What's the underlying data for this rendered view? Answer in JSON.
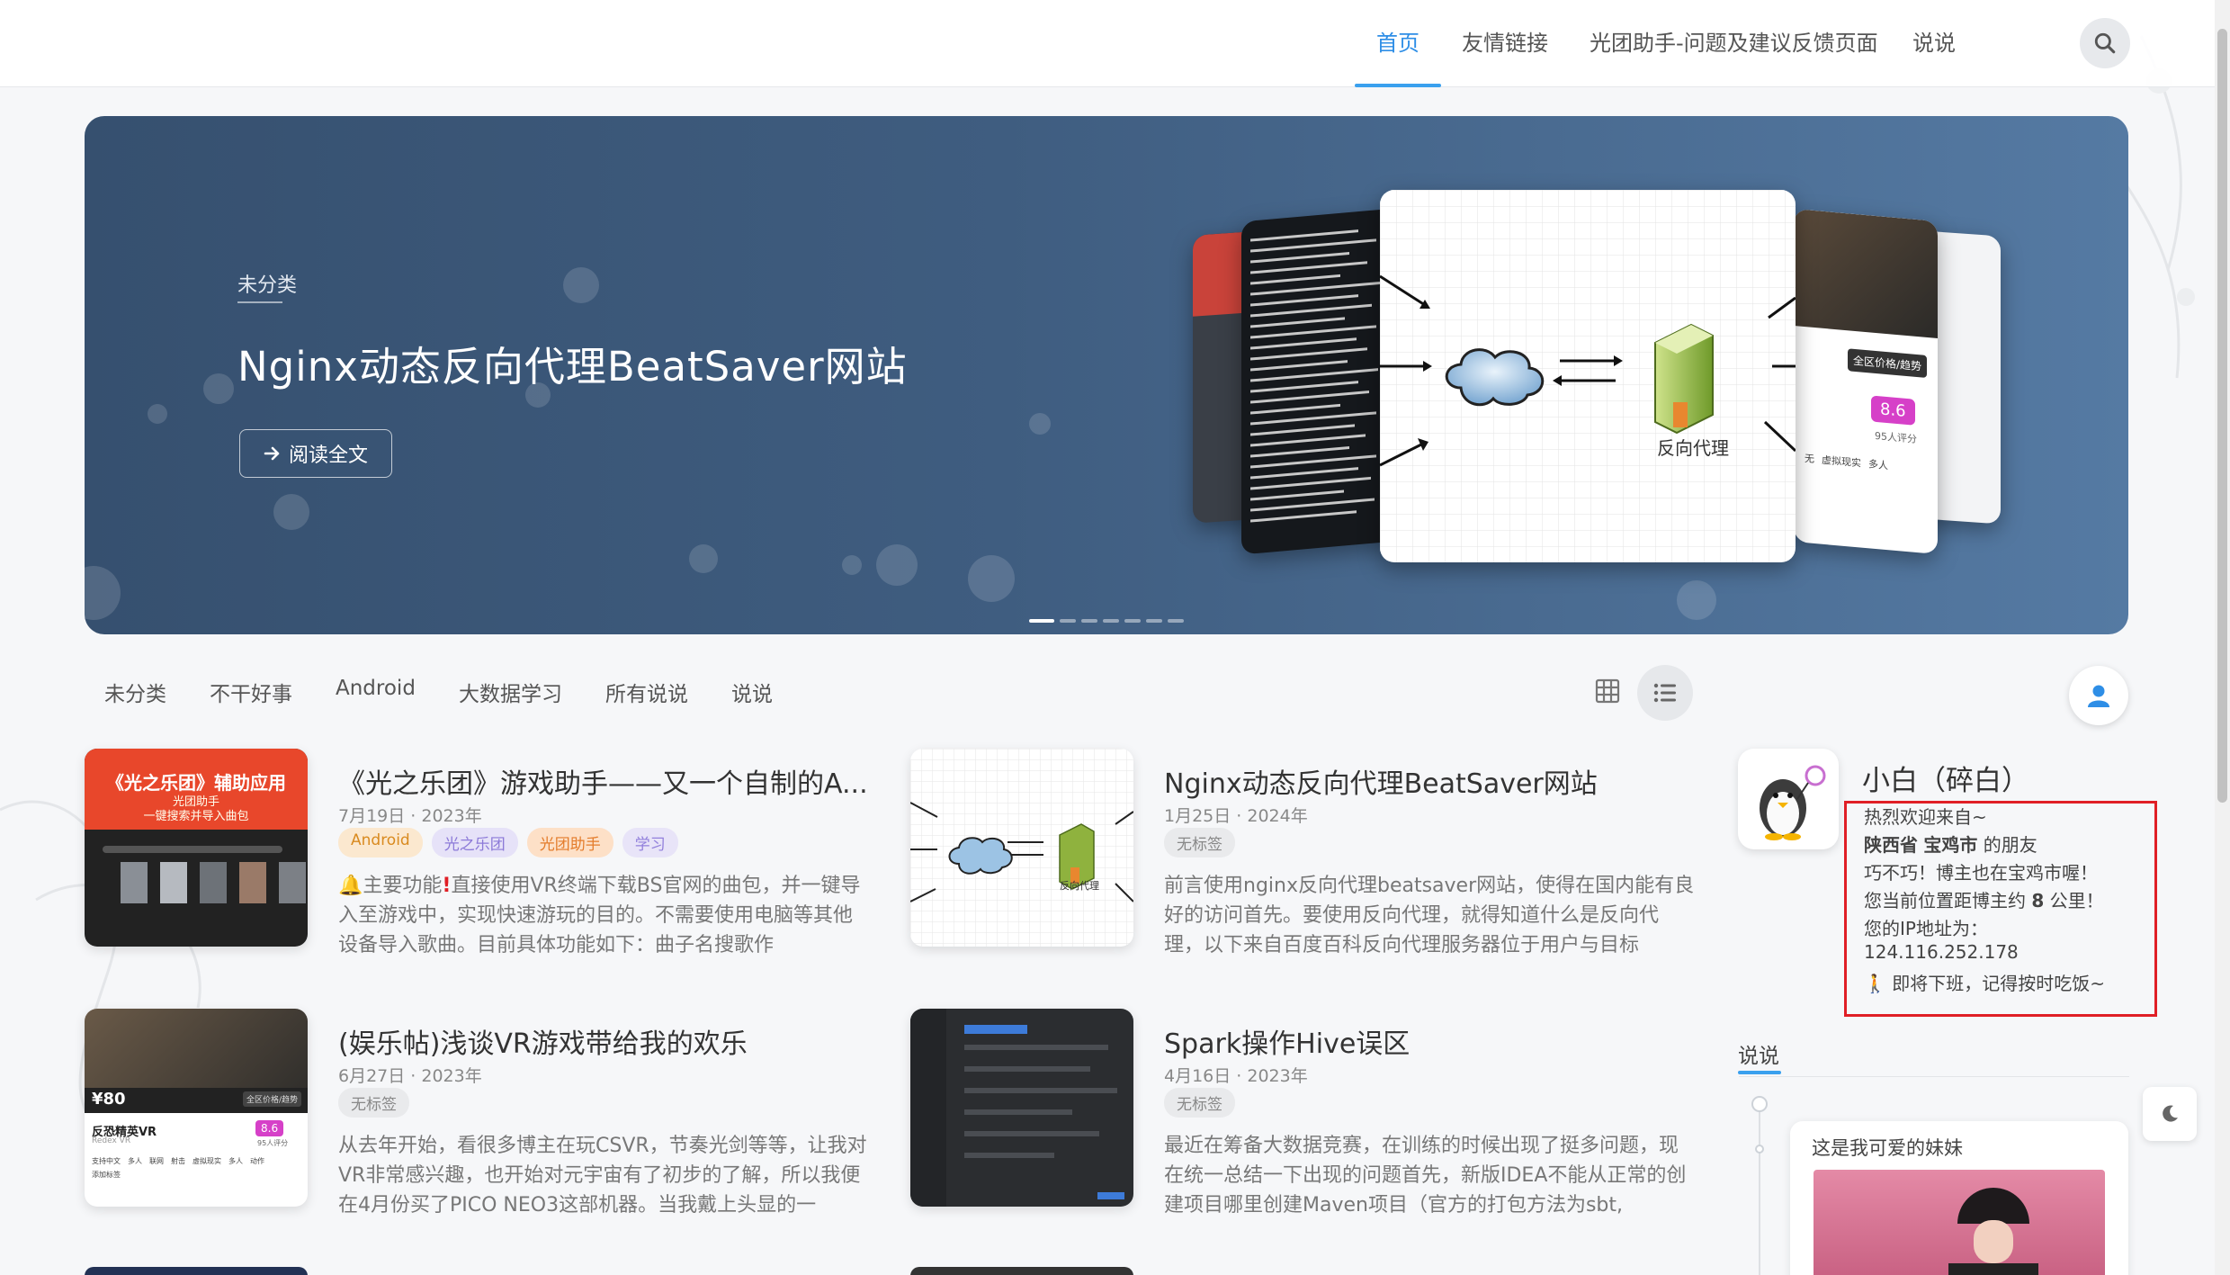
{
  "nav": {
    "items": [
      {
        "label": "首页",
        "active": true
      },
      {
        "label": "友情链接",
        "active": false
      },
      {
        "label": "光团助手-问题及建议反馈页面",
        "active": false
      },
      {
        "label": "说说",
        "active": false
      }
    ],
    "search_icon": "search-icon"
  },
  "hero": {
    "category": "未分类",
    "title": "Nginx动态反向代理BeatSaver网站",
    "read_button": "阅读全文",
    "read_icon": "arrow-right-icon",
    "diagram_label": "反向代理",
    "card_price": "8.6",
    "card_price_caption": "95人评分",
    "card_button": "全区价格/趋势",
    "card_tags": [
      "无",
      "虚拟现实",
      "多人"
    ],
    "slide_count": 7,
    "active_slide": 1
  },
  "categories": [
    "未分类",
    "不干好事",
    "Android",
    "大数据学习",
    "所有说说",
    "说说"
  ],
  "posts": [
    {
      "title": "《光之乐团》游戏助手——又一个自制的A...",
      "date": "7月19日 · 2023年",
      "tags": [
        {
          "label": "Android",
          "style": "and"
        },
        {
          "label": "光之乐团",
          "style": "gzl"
        },
        {
          "label": "光团助手",
          "style": "gzs"
        },
        {
          "label": "学习",
          "style": "xx"
        }
      ],
      "excerpt_icon": "bell-icon",
      "excerpt_mark_icon": "exclamation-icon",
      "excerpt_prefix": "主要功能",
      "excerpt": "直接使用VR终端下载BS官网的曲包，并一键导入至游戏中，实现快速游玩的目的。不需要使用电脑等其他设备导入歌曲。目前具体功能如下：曲子名搜歌作",
      "thumb_title": "《光之乐团》辅助应用",
      "thumb_sub1": "光团助手",
      "thumb_sub2": "一键搜索并导入曲包"
    },
    {
      "title": "Nginx动态反向代理BeatSaver网站",
      "date": "1月25日 · 2024年",
      "tags": [
        {
          "label": "无标签",
          "style": "none"
        }
      ],
      "excerpt": "前言使用nginx反向代理beatsaver网站，使得在国内能有良好的访问首先。要使用反向代理，就得知道什么是反向代理，以下来自百度百科反向代理服务器位于用户与目标",
      "thumb_label": "反向代理"
    },
    {
      "title": "(娱乐帖)浅谈VR游戏带给我的欢乐",
      "date": "6月27日 · 2023年",
      "tags": [
        {
          "label": "无标签",
          "style": "none"
        }
      ],
      "excerpt": "从去年开始，看很多博主在玩CSVR，节奏光剑等等，让我对VR非常感兴趣，也开始对元宇宙有了初步的了解，所以我便在4月份买了PICO NEO3这部机器。当我戴上头显的一",
      "thumb_price": "¥80",
      "thumb_game": "反恐精英VR",
      "thumb_sub": "Redex VR",
      "thumb_score": "8.6",
      "thumb_score_caption": "95人评分",
      "thumb_button": "全区价格/趋势",
      "thumb_tags": [
        "支持中文",
        "多人",
        "联网",
        "射击",
        "虚拟现实",
        "多人",
        "动作",
        "添加标签"
      ]
    },
    {
      "title": "Spark操作Hive误区",
      "date": "4月16日 · 2023年",
      "tags": [
        {
          "label": "无标签",
          "style": "none"
        }
      ],
      "excerpt": "最近在筹备大数据竞赛，在训练的时候出现了挺多问题，现在统一总结一下出现的问题首先，新版IDEA不能从正常的创建项目哪里创建Maven项目（官方的打包方法为sbt,"
    }
  ],
  "profile": {
    "name": "小白（碎白）",
    "welcome": "热烈欢迎来自~",
    "province": "陕西省",
    "city": "宝鸡市",
    "friend_suffix": "的朋友",
    "coincidence": "巧不巧！博主也在宝鸡市喔！",
    "distance_prefix": "您当前位置距博主约",
    "distance_km": "8",
    "distance_suffix": "公里！",
    "ip_label": "您的IP地址为：",
    "ip": "124.116.252.178",
    "walker_icon": "walking-person-icon",
    "farewell": "即将下班，记得按时吃饭~"
  },
  "says": {
    "title": "说说",
    "item_text": "这是我可爱的妹妹"
  },
  "buttons": {
    "grid_view": "grid-view-icon",
    "list_view": "list-view-icon",
    "user": "user-icon",
    "dark_mode": "moon-icon"
  },
  "colors": {
    "accent": "#2e8ee6",
    "hero_bg": "#3f5d80",
    "highlight_box": "#e01f26"
  }
}
